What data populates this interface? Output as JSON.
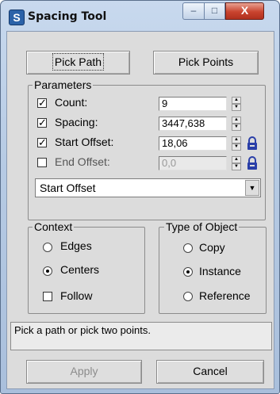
{
  "window": {
    "title": "Spacing Tool",
    "icon_letter": "S",
    "controls": {
      "minimize": "‒",
      "maximize": "□",
      "close": "X"
    }
  },
  "pick": {
    "path_label": "Pick Path",
    "points_label": "Pick Points"
  },
  "parameters": {
    "label": "Parameters",
    "rows": [
      {
        "label": "Count:",
        "checked": true,
        "value": "9",
        "enabled": true
      },
      {
        "label": "Spacing:",
        "checked": true,
        "value": "3447,638",
        "enabled": true
      },
      {
        "label": "Start Offset:",
        "checked": true,
        "value": "18,06",
        "enabled": true,
        "lock": "lock-icon"
      },
      {
        "label": "End Offset:",
        "checked": false,
        "value": "0,0",
        "enabled": false,
        "lock": "lock-icon"
      }
    ],
    "dropdown_value": "Start Offset"
  },
  "context": {
    "label": "Context",
    "options": [
      "Edges",
      "Centers"
    ],
    "selected": "Centers",
    "follow_label": "Follow",
    "follow_checked": false
  },
  "object_type": {
    "label": "Type of Object",
    "options": [
      "Copy",
      "Instance",
      "Reference"
    ],
    "selected": "Instance"
  },
  "status_text": "Pick a path or pick two points.",
  "footer": {
    "apply_label": "Apply",
    "cancel_label": "Cancel"
  },
  "colors": {
    "lock_icon": "#2a3fa8",
    "close_button": "#c9442f",
    "frame": "#b7cbe4"
  }
}
